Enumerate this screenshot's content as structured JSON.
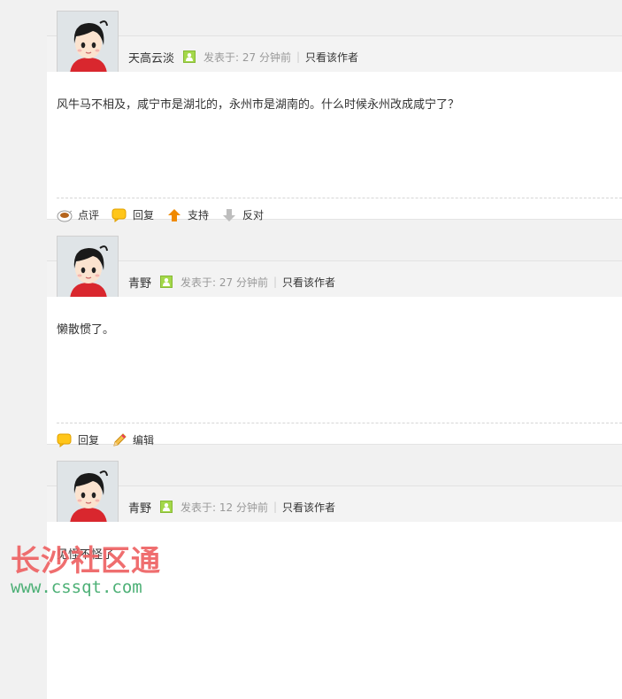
{
  "posts": [
    {
      "author": "天高云淡",
      "posted": "发表于: 27 分钟前",
      "separator": "|",
      "only_author": "只看该作者",
      "content": "风牛马不相及，咸宁市是湖北的，永州市是湖南的。什么时候永州改成咸宁了？",
      "actions": [
        {
          "label": "点评",
          "icon": "comment-icon"
        },
        {
          "label": "回复",
          "icon": "reply-icon"
        },
        {
          "label": "支持",
          "icon": "support-up-icon"
        },
        {
          "label": "反对",
          "icon": "oppose-down-icon"
        }
      ]
    },
    {
      "author": "青野",
      "posted": "发表于: 27 分钟前",
      "separator": "|",
      "only_author": "只看该作者",
      "content": "懒散惯了。",
      "actions": [
        {
          "label": "回复",
          "icon": "reply-icon"
        },
        {
          "label": "编辑",
          "icon": "edit-pencil-icon"
        }
      ]
    },
    {
      "author": "青野",
      "posted": "发表于: 12 分钟前",
      "separator": "|",
      "only_author": "只看该作者",
      "content": "见怪不怪了",
      "actions": []
    }
  ],
  "watermark": {
    "title": "长沙社区通",
    "url": "www.cssqt.com"
  },
  "colors": {
    "accent_orange": "#f08a00",
    "online_green": "#a4d84a",
    "watermark_red": "#ee5f60",
    "watermark_green": "#3aa868"
  }
}
